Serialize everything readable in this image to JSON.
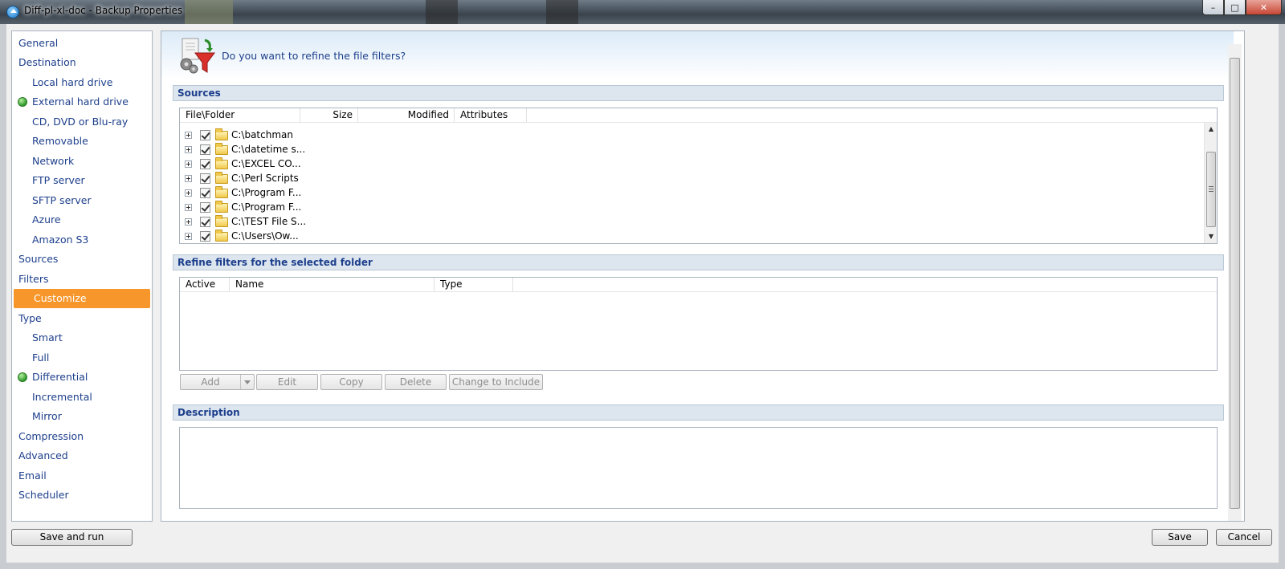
{
  "window": {
    "title": "Diff-pl-xl-doc - Backup Properties",
    "controls": {
      "minimize": "–",
      "maximize": "□",
      "close": "✕"
    }
  },
  "sidebar": {
    "items": [
      {
        "label": "General",
        "level": 1
      },
      {
        "label": "Destination",
        "level": 1
      },
      {
        "label": "Local hard drive",
        "level": 2
      },
      {
        "label": "External hard drive",
        "level": 2,
        "status": "selected"
      },
      {
        "label": "CD, DVD or Blu-ray",
        "level": 2
      },
      {
        "label": "Removable",
        "level": 2
      },
      {
        "label": "Network",
        "level": 2
      },
      {
        "label": "FTP server",
        "level": 2
      },
      {
        "label": "SFTP server",
        "level": 2
      },
      {
        "label": "Azure",
        "level": 2
      },
      {
        "label": "Amazon S3",
        "level": 2
      },
      {
        "label": "Sources",
        "level": 1
      },
      {
        "label": "Filters",
        "level": 1
      },
      {
        "label": "Customize",
        "level": 2,
        "active": true
      },
      {
        "label": "Type",
        "level": 1
      },
      {
        "label": "Smart",
        "level": 2
      },
      {
        "label": "Full",
        "level": 2
      },
      {
        "label": "Differential",
        "level": 2,
        "status": "selected"
      },
      {
        "label": "Incremental",
        "level": 2
      },
      {
        "label": "Mirror",
        "level": 2
      },
      {
        "label": "Compression",
        "level": 1
      },
      {
        "label": "Advanced",
        "level": 1
      },
      {
        "label": "Email",
        "level": 1
      },
      {
        "label": "Scheduler",
        "level": 1
      }
    ],
    "accent_color": "#f7962b",
    "status_color": "#2f9a2a"
  },
  "main": {
    "question": "Do you want to refine the file filters?",
    "sources": {
      "title": "Sources",
      "columns": [
        "File\\Folder",
        "Size",
        "Modified",
        "Attributes"
      ],
      "rows": [
        {
          "path": "C:\\batchman",
          "checked": true
        },
        {
          "path": "C:\\datetime s...",
          "checked": true
        },
        {
          "path": "C:\\EXCEL CO...",
          "checked": true
        },
        {
          "path": "C:\\Perl Scripts",
          "checked": true
        },
        {
          "path": "C:\\Program F...",
          "checked": true
        },
        {
          "path": "C:\\Program F...",
          "checked": true
        },
        {
          "path": "C:\\TEST File S...",
          "checked": true
        },
        {
          "path": "C:\\Users\\Ow...",
          "checked": true
        }
      ]
    },
    "refine": {
      "title": "Refine filters for the selected folder",
      "columns": [
        "Active",
        "Name",
        "Type"
      ],
      "buttons": {
        "add": "Add",
        "edit": "Edit",
        "copy": "Copy",
        "delete": "Delete",
        "change": "Change to Include"
      }
    },
    "description": {
      "title": "Description"
    }
  },
  "footer": {
    "save_and_run": "Save and run",
    "save": "Save",
    "cancel": "Cancel"
  }
}
